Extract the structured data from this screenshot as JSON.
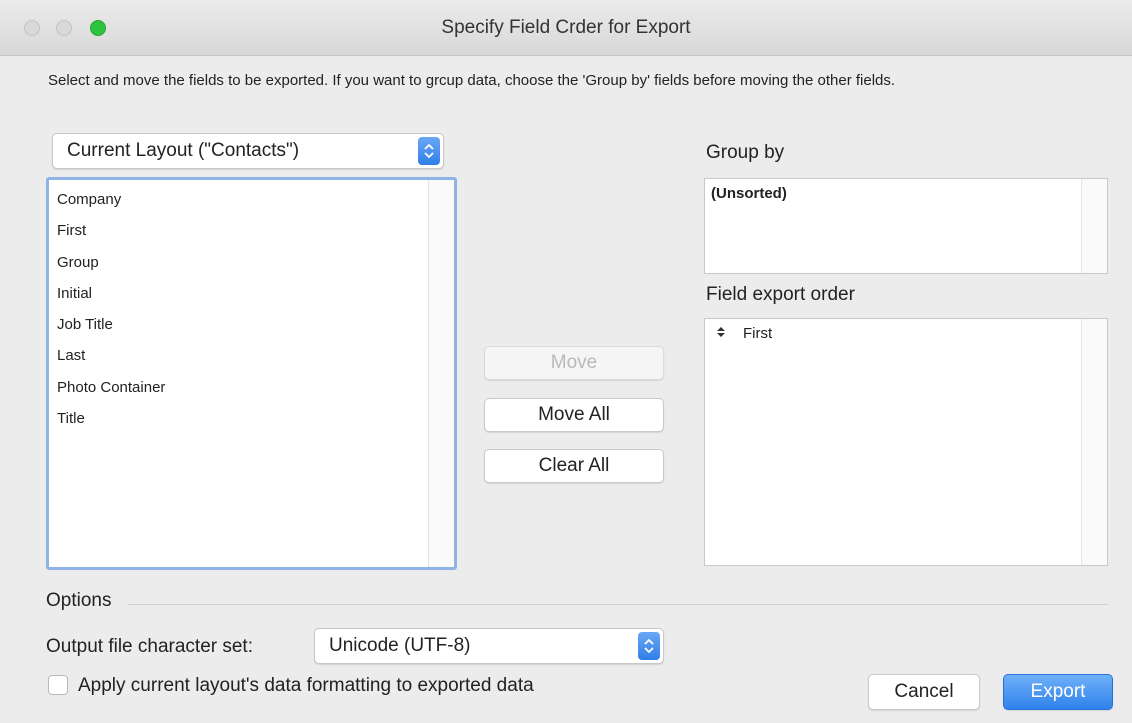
{
  "window": {
    "title": "Specify Field Crder for Export"
  },
  "instructions": "Select and move the fields to be exported.  If you want to grcup data, choose the 'Group by' fields before moving the other fields.",
  "source": {
    "selected": "Current Layout (\"Contacts\")",
    "fields": [
      "Company",
      "First",
      "Group",
      "Initial",
      "Job Title",
      "Last",
      "Photo Container",
      "Title"
    ]
  },
  "buttons": {
    "move": "Move",
    "move_all": "Move All",
    "clear_all": "Clear All",
    "cancel": "Cancel",
    "export": "Export"
  },
  "group_by": {
    "label": "Group by",
    "entries": [
      "(Unsorted)"
    ]
  },
  "export_order": {
    "label": "Field export order",
    "entries": [
      "First"
    ]
  },
  "options": {
    "label": "Options",
    "charset_label": "Output file character set:",
    "charset_value": "Unicode (UTF-8)",
    "apply_formatting_label": "Apply current layout's data formatting to exported data"
  },
  "colors": {
    "accent": "#2f82ec",
    "focus_ring": "#8fb3e6",
    "zoom_button": "#2ec33e"
  }
}
